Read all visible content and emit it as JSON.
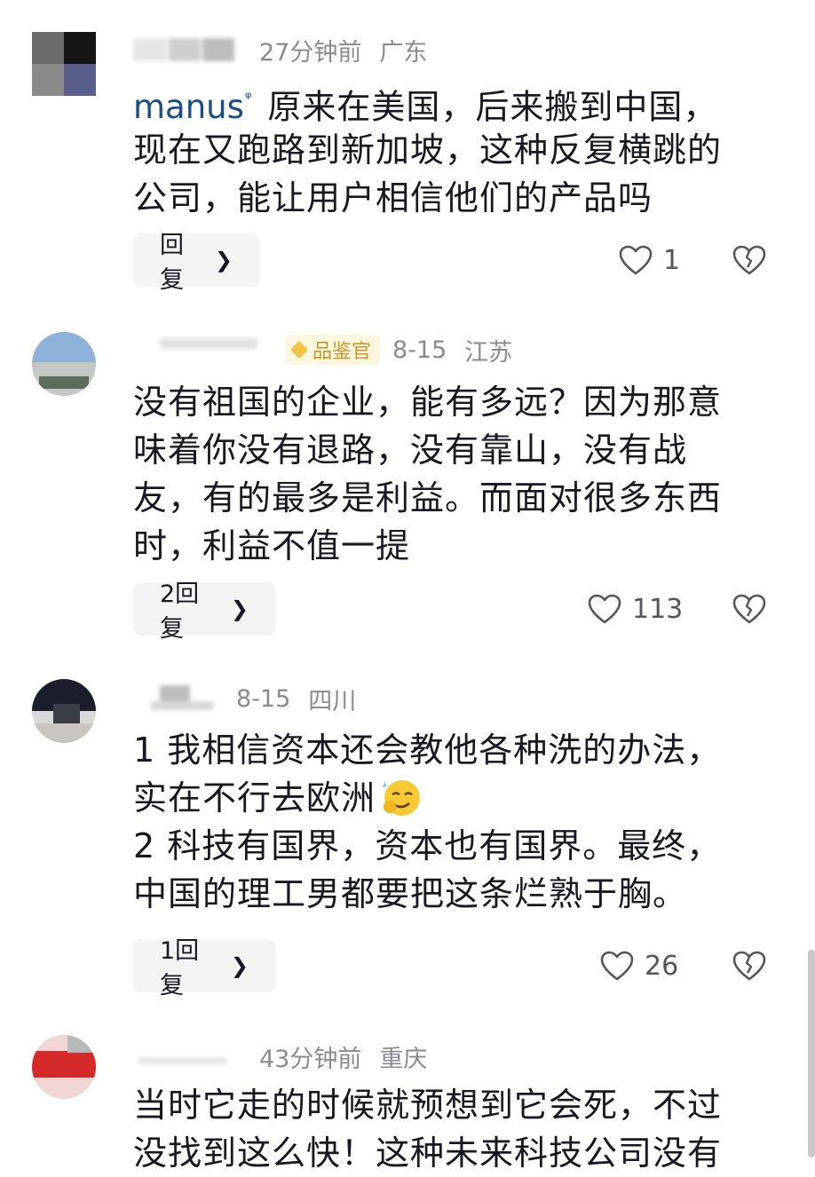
{
  "comments": [
    {
      "time": "27分钟前",
      "location": "广东",
      "logo_text": "manus",
      "lines": [
        "原来在美国，后来搬到中国，",
        "现在又跑路到新加坡，这种反复横跳的",
        "公司，能让用户相信他们的产品吗"
      ],
      "reply_label": "回复",
      "likes": "1"
    },
    {
      "badge": "品鉴官",
      "time": "8-15",
      "location": "江苏",
      "lines": [
        "没有祖国的企业，能有多远？因为那意",
        "味着你没有退路，没有靠山，没有战",
        "友，有的最多是利益。而面对很多东西",
        "时，利益不值一提"
      ],
      "reply_label": "2回复",
      "likes": "113"
    },
    {
      "time": "8-15",
      "location": "四川",
      "lines": [
        "1 我相信资本还会教他各种洗的办法，",
        "实在不行去欧洲",
        "2 科技有国界，资本也有国界。最终，",
        "中国的理工男都要把这条烂熟于胸。"
      ],
      "reply_label": "1回复",
      "likes": "26"
    },
    {
      "time": "43分钟前",
      "location": "重庆",
      "lines": [
        "当时它走的时候就预想到它会死，不过",
        "没找到这么快！这种未来科技公司没有"
      ]
    }
  ],
  "icons": {
    "like": "heart-outline-icon",
    "dislike": "broken-heart-icon",
    "reply_chevron": "chevron-right-icon"
  },
  "colors": {
    "meta": "#8a8b91",
    "text": "#161823",
    "reply_bg": "#f4f4f5",
    "logo": "#1a4e8a",
    "badge": "#c9962a"
  }
}
